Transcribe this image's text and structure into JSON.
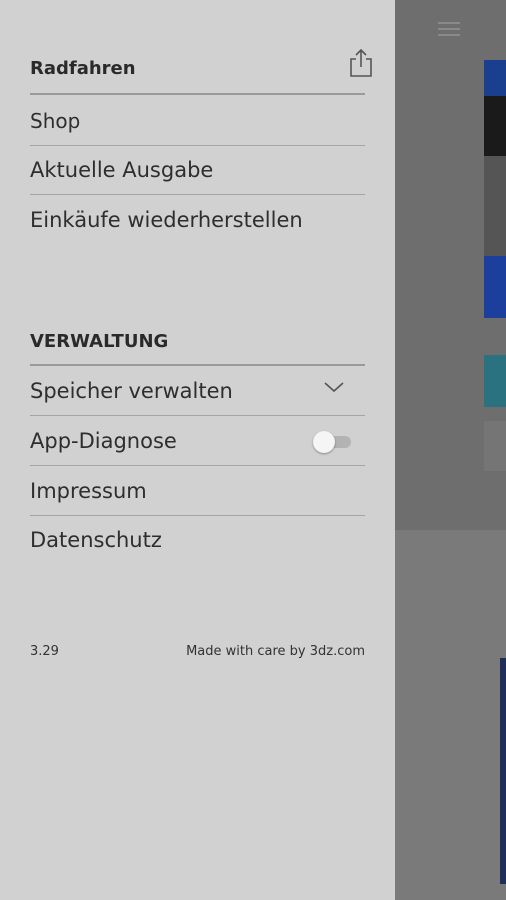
{
  "drawer": {
    "header_title": "Radfahren",
    "items": [
      {
        "label": "Shop"
      },
      {
        "label": "Aktuelle Ausgabe"
      },
      {
        "label": "Einkäufe wiederherstellen"
      }
    ],
    "admin_title": "VERWALTUNG",
    "admin_items": [
      {
        "label": "Speicher verwalten"
      },
      {
        "label": "App-Diagnose"
      },
      {
        "label": "Impressum"
      },
      {
        "label": "Datenschutz"
      }
    ],
    "app_diagnose_enabled": false,
    "version": "3.29",
    "credit": "Made with care by 3dz.com"
  },
  "colors": {
    "drawer_bg": "#d1d1d1",
    "overlay_bg": "#6b6b6b",
    "text": "#2e2e2e"
  }
}
